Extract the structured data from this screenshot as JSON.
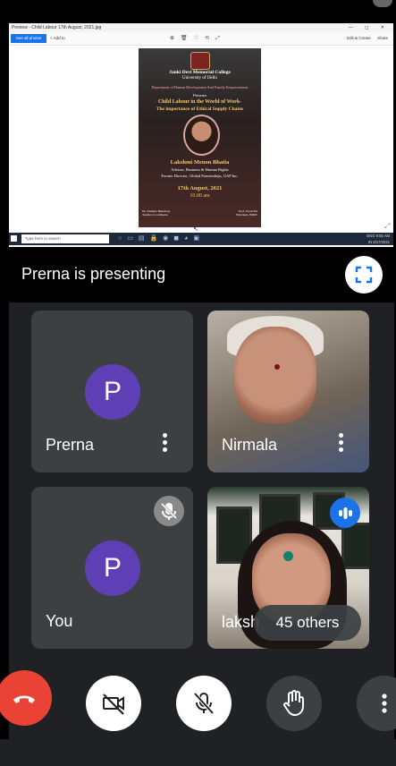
{
  "shared_screen": {
    "window_title": "Preview - Child Labour 17th August, 2021.jpg",
    "window_controls": "— ◻ ✕",
    "toolbar": {
      "see_all_photos": "See all photos",
      "add_to": "+ Add to",
      "edit_create": "Edit & Create",
      "share": "Share"
    },
    "poster": {
      "college": "Janki Devi Memorial College",
      "university": "University of Delhi",
      "department": "Department of Human Development And Family Empowerment",
      "presents": "Presents",
      "title_line1": "Child Labour in the World of Work-",
      "title_line2": "The importance of Ethical Supply Chains",
      "speaker": "Lakshmi Menon Bhatia",
      "speaker_role1": "Advisor, Business & Human Rights",
      "speaker_role2": "Former Director, Global Partnerships, GAP Inc.",
      "date": "17th August, 2021",
      "time": "10.00 am",
      "footer_left": "Dr. Nirmala Bhardwaj",
      "footer_left_role": "Teacher Coordinator",
      "footer_right": "Prof. Swati Pal",
      "footer_right_role": "Principal, JDMC"
    },
    "taskbar": {
      "search_placeholder": "Type here to search",
      "lang": "ENG",
      "region": "IN",
      "time": "9:55 AM",
      "date": "8/17/2021"
    }
  },
  "presenting": {
    "label": "Prerna is presenting"
  },
  "participants": [
    {
      "name": "Prerna",
      "initial": "P"
    },
    {
      "name": "Nirmala"
    },
    {
      "name": "You",
      "initial": "P"
    },
    {
      "name": "laksh",
      "others_label": "45 others"
    }
  ],
  "colors": {
    "meet_bg": "#202124",
    "tile_bg": "#3c4043",
    "avatar": "#5f3fb5",
    "hangup": "#ea4335",
    "speaking": "#1a73e8"
  },
  "icons": {
    "fullscreen": "fullscreen-icon",
    "more": "more-vert-icon",
    "mic_off": "mic-off-icon",
    "speaking": "audio-level-icon",
    "hangup": "call-end-icon",
    "camera_off": "videocam-off-icon",
    "hand": "raise-hand-icon"
  }
}
